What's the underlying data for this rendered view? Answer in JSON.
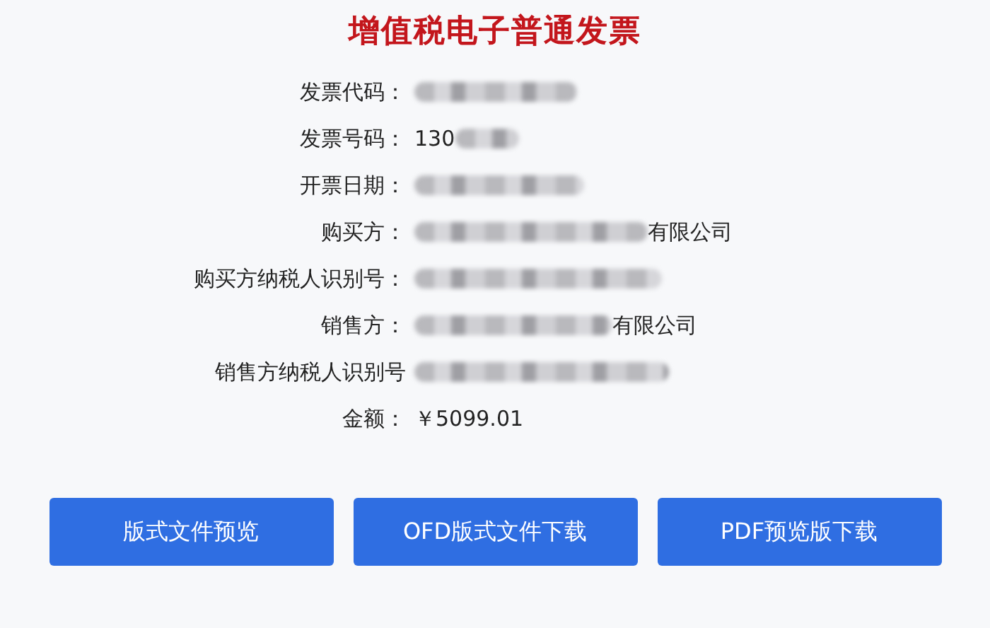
{
  "title": "增值税电子普通发票",
  "fields": [
    {
      "label": "发票代码：",
      "redacted": true
    },
    {
      "label": "发票号码：",
      "value": "130",
      "redacted": true
    },
    {
      "label": "开票日期：",
      "redacted": true
    },
    {
      "label": "购买方：",
      "redacted": true,
      "suffix": "有限公司"
    },
    {
      "label": "购买方纳税人识别号：",
      "redacted": true
    },
    {
      "label": "销售方：",
      "redacted": true,
      "suffix": "有限公司"
    },
    {
      "label": "销售方纳税人识别号",
      "redacted": true
    },
    {
      "label": "金额：",
      "value": "￥5099.01"
    }
  ],
  "buttons": [
    "版式文件预览",
    "OFD版式文件下载",
    "PDF预览版下载"
  ]
}
